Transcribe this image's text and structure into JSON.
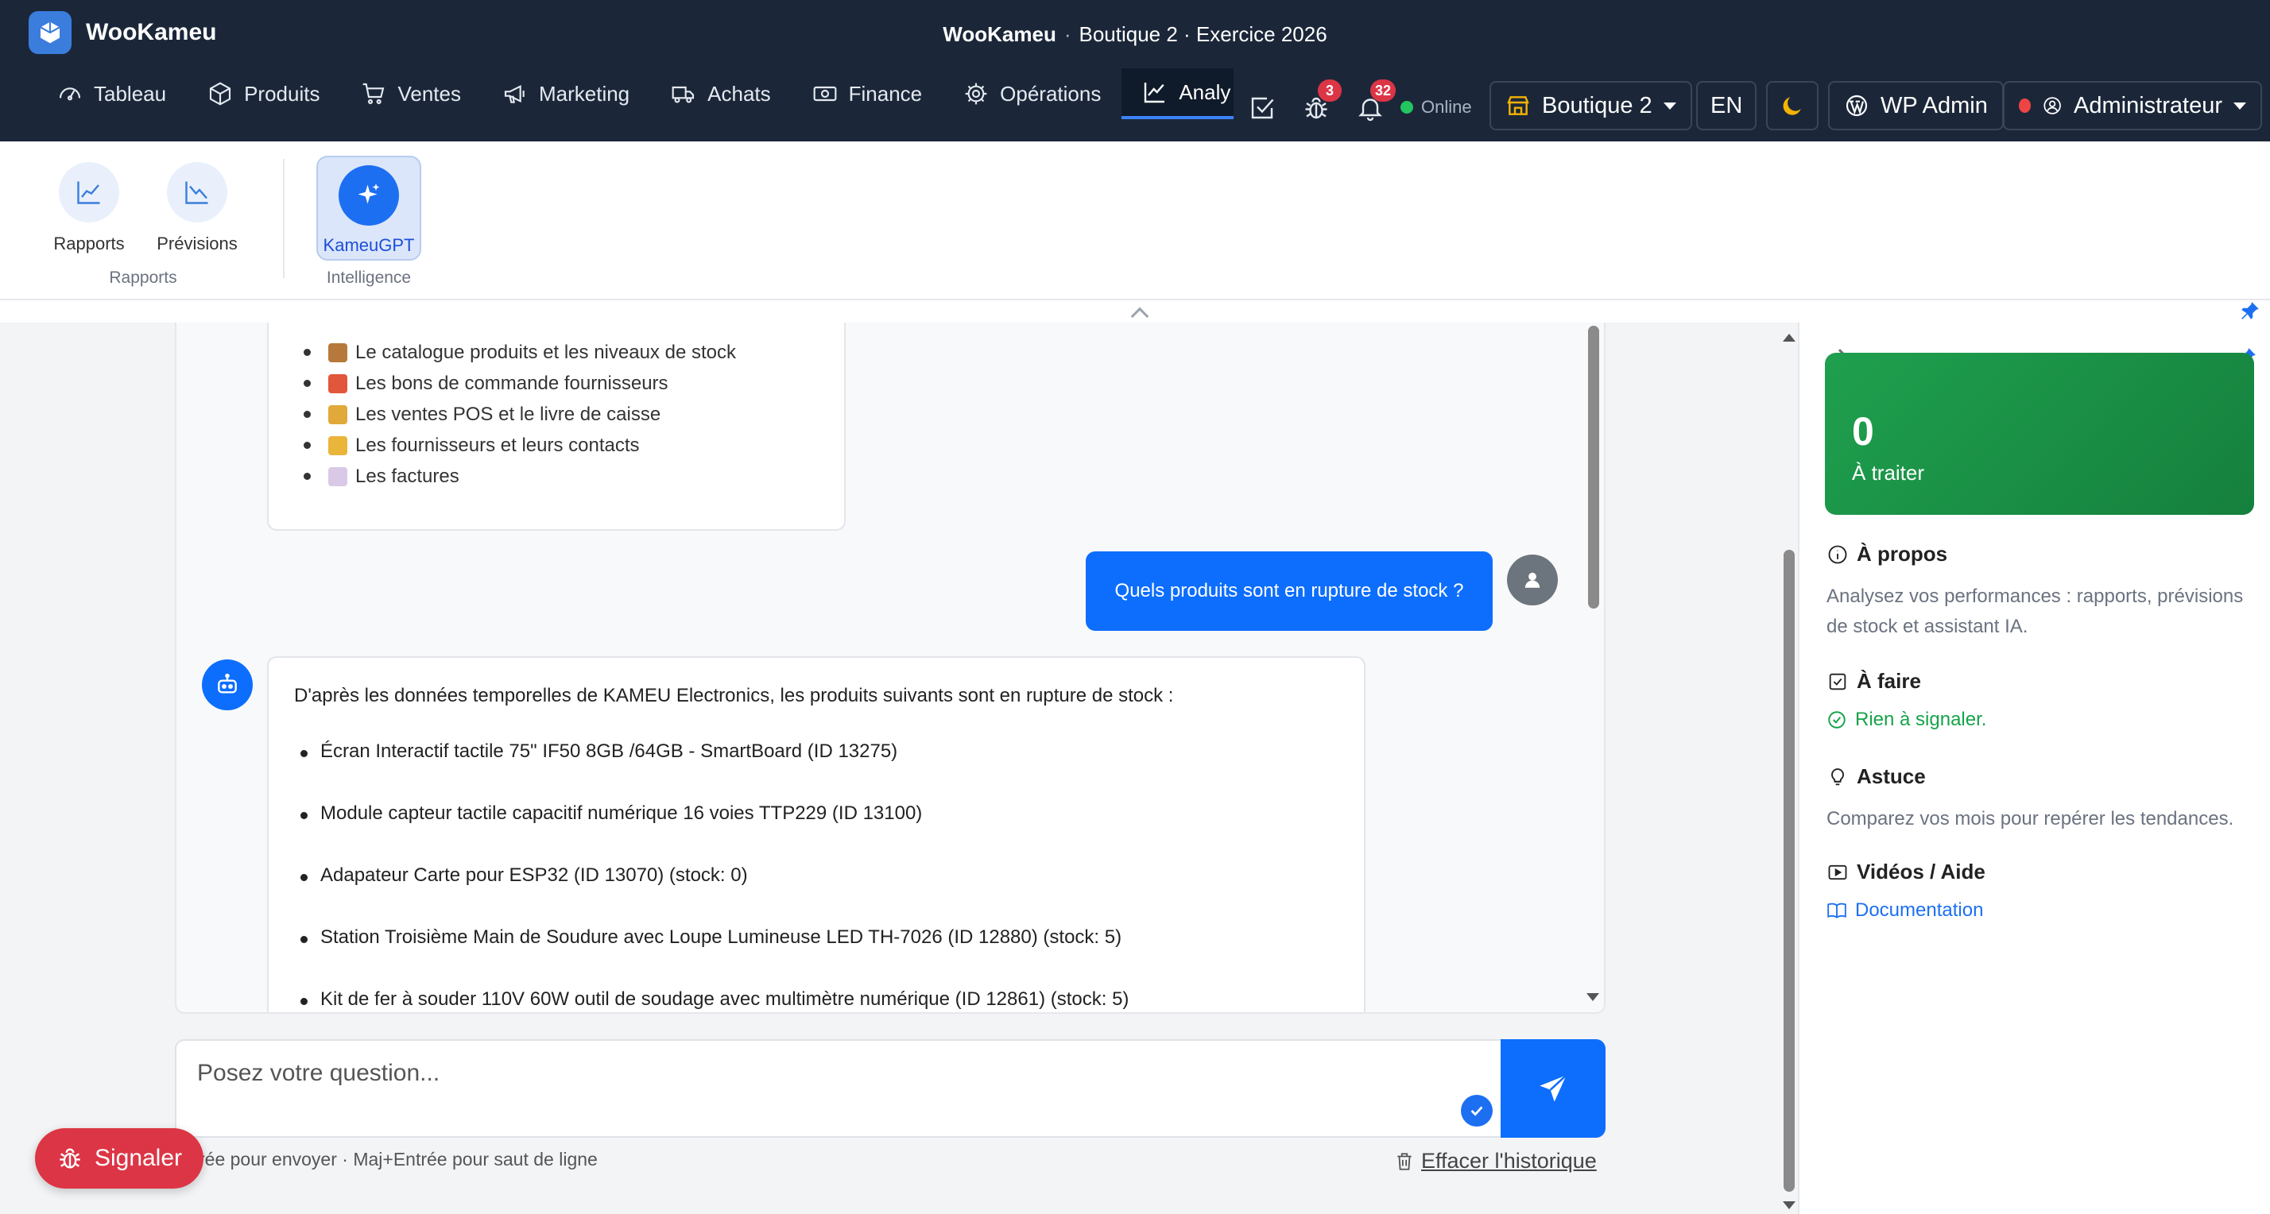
{
  "app": {
    "name": "WooKameu",
    "title_app": "WooKameu",
    "title_sep": "·",
    "title_context": "Boutique 2 · Exercice 2026"
  },
  "nav": {
    "tabs": [
      {
        "label": "Tableau",
        "icon": "gauge-icon"
      },
      {
        "label": "Produits",
        "icon": "box-icon"
      },
      {
        "label": "Ventes",
        "icon": "cart-icon"
      },
      {
        "label": "Marketing",
        "icon": "megaphone-icon"
      },
      {
        "label": "Achats",
        "icon": "truck-icon"
      },
      {
        "label": "Finance",
        "icon": "cash-icon"
      },
      {
        "label": "Opérations",
        "icon": "gear-icon"
      },
      {
        "label": "Analy",
        "icon": "chart-line-icon",
        "active": true
      }
    ],
    "bug_count": "3",
    "notif_count": "32",
    "status": "Online",
    "store": "Boutique 2",
    "lang": "EN",
    "wp_admin": "WP Admin",
    "user": "Administrateur"
  },
  "ribbon": {
    "items": [
      {
        "label": "Rapports"
      },
      {
        "label": "Prévisions"
      },
      {
        "label": "KameuGPT"
      }
    ],
    "groups": [
      "Rapports",
      "Intelligence"
    ]
  },
  "chat": {
    "first_list": [
      "Le catalogue produits et les niveaux de stock",
      "Les bons de commande fournisseurs",
      "Les ventes POS et le livre de caisse",
      "Les fournisseurs et leurs contacts",
      "Les factures"
    ],
    "first_list_emoji_colors": [
      "#b7793b",
      "#e2563b",
      "#e0a93a",
      "#e9b53a",
      "#d9c8e6"
    ],
    "user_message": "Quels produits sont en rupture de stock ?",
    "ai_intro": "D'après les données temporelles de KAMEU Electronics, les produits suivants sont en rupture de stock :",
    "ai_items": [
      "Écran Interactif tactile 75\" IF50 8GB /64GB - SmartBoard (ID 13275)",
      "Module capteur tactile capacitif numérique 16 voies TTP229 (ID 13100)",
      "Adapateur Carte pour ESP32 (ID 13070) (stock: 0)",
      "Station Troisième Main de Soudure avec Loupe Lumineuse LED TH-7026 (ID 12880) (stock: 5)",
      "Kit de fer à souder 110V 60W outil de soudage avec multimètre numérique (ID 12861) (stock: 5)"
    ]
  },
  "input": {
    "placeholder": "Posez votre question...",
    "hint": "rée pour envoyer · Maj+Entrée pour saut de ligne",
    "clear": "Effacer l'historique"
  },
  "report_button": "Signaler",
  "right_panel": {
    "count": "0",
    "count_label": "À traiter",
    "about_title": "À propos",
    "about_text": "Analysez vos performances : rapports, prévisions de stock et assistant IA.",
    "todo_title": "À faire",
    "todo_text": "Rien à signaler.",
    "tip_title": "Astuce",
    "tip_text": "Comparez vos mois pour repérer les tendances.",
    "videos_title": "Vidéos / Aide",
    "doc_link": "Documentation"
  },
  "colors": {
    "topbar": "#1b2739",
    "primary": "#0d6efd",
    "danger": "#dc3545",
    "success": "#16a34a"
  }
}
